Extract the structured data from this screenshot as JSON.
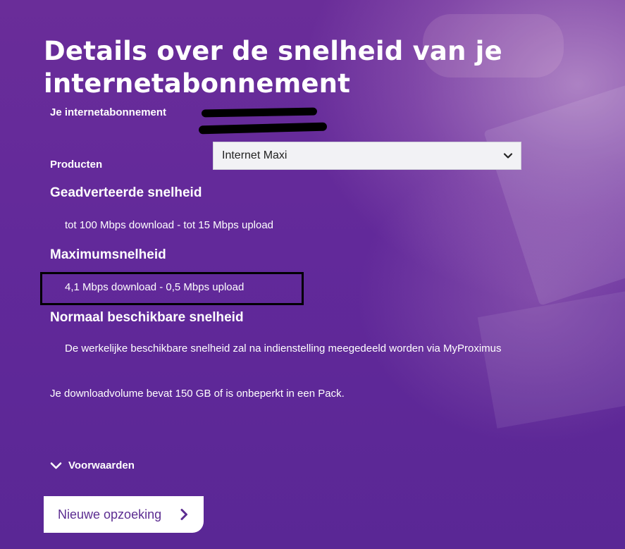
{
  "page": {
    "title": "Details over de snelheid van je internetabonnement"
  },
  "subscription": {
    "label": "Je internetabonnement"
  },
  "products": {
    "label": "Producten",
    "selected": "Internet Maxi"
  },
  "advertised": {
    "heading": "Geadverteerde snelheid",
    "text": "tot 100 Mbps download - tot 15 Mbps upload"
  },
  "maximum": {
    "heading": "Maximumsnelheid",
    "text": "4,1 Mbps download - 0,5 Mbps upload"
  },
  "normal": {
    "heading": "Normaal beschikbare snelheid",
    "text": "De werkelijke beschikbare snelheid zal na indienstelling meegedeeld worden via MyProximus"
  },
  "volume": {
    "text": "Je downloadvolume bevat 150 GB of is onbeperkt in een Pack."
  },
  "terms": {
    "label": "Voorwaarden"
  },
  "new_search": {
    "label": "Nieuwe opzoeking"
  },
  "icons": {
    "select": "chevron-down-icon",
    "terms": "chevron-down-icon",
    "button": "chevron-right-icon"
  },
  "colors": {
    "background": "#5e2a93",
    "button_text": "#5c2d91",
    "button_bg": "#ffffff"
  }
}
